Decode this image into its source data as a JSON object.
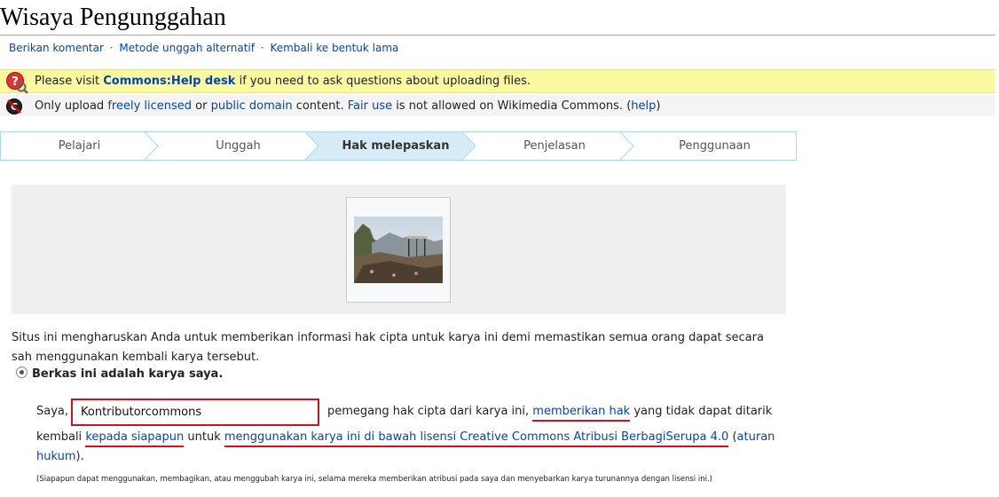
{
  "page": {
    "title": "Wisaya Pengunggahan"
  },
  "subnav": {
    "items": [
      "Berikan komentar",
      "Metode unggah alternatif",
      "Kembali ke bentuk lama"
    ],
    "separator": "·"
  },
  "notices": {
    "help_prefix": "Please visit",
    "help_link": "Commons:Help desk",
    "help_suffix": "if you need to ask questions about uploading files.",
    "upload_prefix": "Only upload",
    "upload_link1": "freely licensed",
    "upload_or": "or",
    "upload_link2": "public domain",
    "upload_mid": "content.",
    "upload_link3": "Fair use",
    "upload_suffix": "is not allowed on Wikimedia Commons. (",
    "upload_link4": "help",
    "upload_close": ")"
  },
  "steps": [
    {
      "label": "Pelajari",
      "active": false
    },
    {
      "label": "Unggah",
      "active": false
    },
    {
      "label": "Hak melepaskan",
      "active": true
    },
    {
      "label": "Penjelasan",
      "active": false
    },
    {
      "label": "Penggunaan",
      "active": false
    }
  ],
  "release": {
    "intro": "Situs ini mengharuskan Anda untuk memberikan informasi hak cipta untuk karya ini demi memastikan semua orang dapat secara sah menggunakan kembali karya tersebut.",
    "option_own_work": "Berkas ini adalah karya saya.",
    "saya_label": "Saya,",
    "author_value": "Kontributorcommons",
    "line1_a": "pemegang hak cipta dari karya ini,",
    "line1_link": "memberikan hak",
    "line1_b": "yang tidak dapat ditarik",
    "line2_a": "kembali",
    "line2_link1": "kepada siapapun",
    "line2_b": "untuk",
    "line2_link2": "menggunakan karya ini di bawah lisensi Creative Commons Atribusi BerbagiSerupa 4.0",
    "line2_paren_open": "(",
    "line2_link3": "aturan",
    "line3_link": "hukum",
    "line3_end": ").",
    "small_note": "(Siapapun dapat menggunakan, membagikan, atau menggubah karya ini, selama mereka memberikan atribusi pada saya dan menyebarkan karya turunannya dengan lisensi ini.)"
  },
  "colors": {
    "link": "#0645ad",
    "help_bar": "#fbf9a0",
    "step_active": "#d8ecf8",
    "highlight_red": "#d1121d"
  }
}
